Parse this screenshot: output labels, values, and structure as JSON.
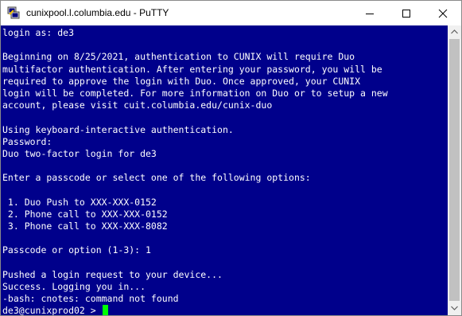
{
  "window": {
    "title": "cunixpool.l.columbia.edu - PuTTY",
    "app_icon": "putty-icon",
    "controls": {
      "minimize_icon": "minimize-icon",
      "maximize_icon": "maximize-icon",
      "close_icon": "close-icon"
    }
  },
  "colors": {
    "terminal_background": "#00008b",
    "terminal_text": "#ffffff",
    "cursor": "#00ff00"
  },
  "terminal": {
    "lines": [
      "login as: de3",
      "",
      "Beginning on 8/25/2021, authentication to CUNIX will require Duo",
      "multifactor authentication. After entering your password, you will be",
      "required to approve the login with Duo. Once approved, your CUNIX",
      "login will be completed. For more information on Duo or to setup a new",
      "account, please visit cuit.columbia.edu/cunix-duo",
      "",
      "Using keyboard-interactive authentication.",
      "Password:",
      "Duo two-factor login for de3",
      "",
      "Enter a passcode or select one of the following options:",
      "",
      " 1. Duo Push to XXX-XXX-0152",
      " 2. Phone call to XXX-XXX-0152",
      " 3. Phone call to XXX-XXX-8082",
      "",
      "Passcode or option (1-3): 1",
      "",
      "Pushed a login request to your device...",
      "Success. Logging you in...",
      "-bash: cnotes: command not found"
    ],
    "prompt": "de3@cunixprod02 > "
  },
  "scrollbar": {
    "up_icon": "scroll-up-arrow-icon",
    "down_icon": "scroll-down-arrow-icon"
  }
}
